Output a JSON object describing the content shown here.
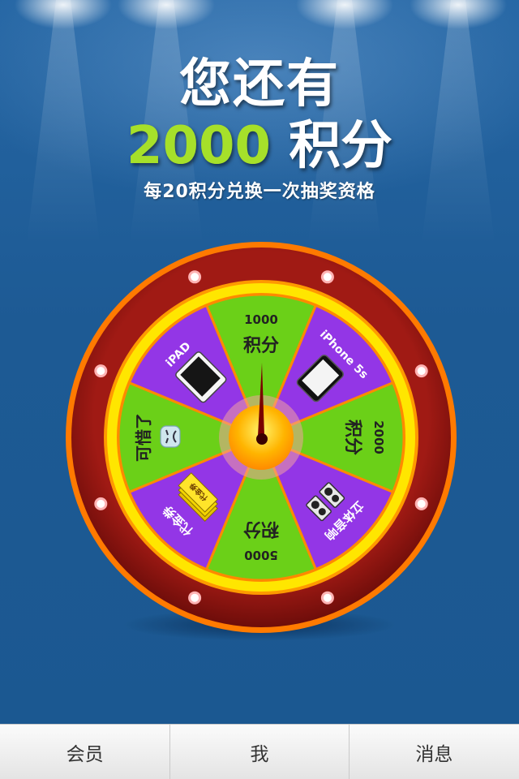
{
  "header": {
    "line1": "您还有",
    "points": "2000",
    "points_unit": "积分",
    "subtitle": "每20积分兑换一次抽奖资格"
  },
  "wheel": {
    "colors": {
      "green": "#6bd018",
      "purple": "#9336e6",
      "rim": "#8e1414",
      "ring_yellow": "#ffe600",
      "ring_orange": "#ff7a00"
    },
    "segments": [
      {
        "label": "1000",
        "label2": "积分",
        "color": "green"
      },
      {
        "label": "iPhone 5s",
        "icon": "iphone-icon",
        "color": "purple"
      },
      {
        "label": "2000",
        "label2": "积分",
        "color": "green"
      },
      {
        "label": "立体音响",
        "icon": "speaker-icon",
        "color": "purple"
      },
      {
        "label": "5000",
        "label2": "积分",
        "color": "green"
      },
      {
        "label": "代金券",
        "icon": "voucher-icon",
        "color": "purple"
      },
      {
        "label": "可惜了",
        "icon": "sad-face-icon",
        "color": "green"
      },
      {
        "label": "iPAD",
        "icon": "ipad-icon",
        "color": "purple"
      }
    ],
    "voucher_text": "代金券"
  },
  "tabbar": {
    "items": [
      {
        "label": "会员"
      },
      {
        "label": "我"
      },
      {
        "label": "消息"
      }
    ]
  }
}
